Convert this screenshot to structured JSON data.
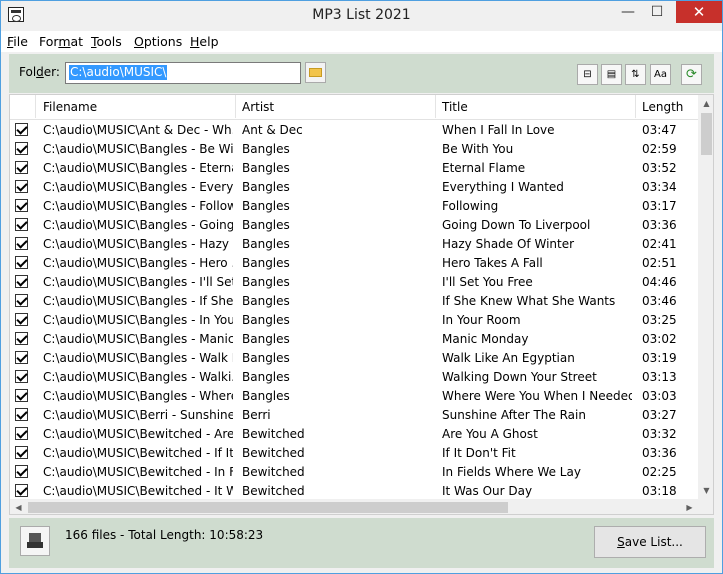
{
  "window": {
    "title": "MP3 List 2021"
  },
  "menu": [
    {
      "pre": "",
      "acc": "F",
      "post": "ile"
    },
    {
      "pre": "For",
      "acc": "m",
      "post": "at"
    },
    {
      "pre": "",
      "acc": "T",
      "post": "ools"
    },
    {
      "pre": "",
      "acc": "O",
      "post": "ptions"
    },
    {
      "pre": "",
      "acc": "H",
      "post": "elp"
    }
  ],
  "toolbar": {
    "folder_label_pre": "Fol",
    "folder_label_acc": "d",
    "folder_label_post": "er:",
    "folder_value": "C:\\audio\\MUSIC\\"
  },
  "columns": {
    "filename": "Filename",
    "artist": "Artist",
    "title": "Title",
    "length": "Length"
  },
  "rows": [
    {
      "file": "C:\\audio\\MUSIC\\Ant & Dec - Wh...",
      "artist": "Ant & Dec",
      "title": "When I Fall In Love",
      "len": "03:47"
    },
    {
      "file": "C:\\audio\\MUSIC\\Bangles - Be Wit...",
      "artist": "Bangles",
      "title": "Be With You",
      "len": "02:59"
    },
    {
      "file": "C:\\audio\\MUSIC\\Bangles - Eterna...",
      "artist": "Bangles",
      "title": "Eternal Flame",
      "len": "03:52"
    },
    {
      "file": "C:\\audio\\MUSIC\\Bangles - Everyt...",
      "artist": "Bangles",
      "title": "Everything I Wanted",
      "len": "03:34"
    },
    {
      "file": "C:\\audio\\MUSIC\\Bangles - Follow...",
      "artist": "Bangles",
      "title": "Following",
      "len": "03:17"
    },
    {
      "file": "C:\\audio\\MUSIC\\Bangles - Going ...",
      "artist": "Bangles",
      "title": "Going Down To Liverpool",
      "len": "03:36"
    },
    {
      "file": "C:\\audio\\MUSIC\\Bangles - Hazy S...",
      "artist": "Bangles",
      "title": "Hazy Shade Of Winter",
      "len": "02:41"
    },
    {
      "file": "C:\\audio\\MUSIC\\Bangles - Hero ...",
      "artist": "Bangles",
      "title": "Hero Takes A Fall",
      "len": "02:51"
    },
    {
      "file": "C:\\audio\\MUSIC\\Bangles - I'll Set ...",
      "artist": "Bangles",
      "title": "I'll Set You Free",
      "len": "04:46"
    },
    {
      "file": "C:\\audio\\MUSIC\\Bangles - If She ...",
      "artist": "Bangles",
      "title": "If She Knew What She Wants",
      "len": "03:46"
    },
    {
      "file": "C:\\audio\\MUSIC\\Bangles - In You...",
      "artist": "Bangles",
      "title": "In Your Room",
      "len": "03:25"
    },
    {
      "file": "C:\\audio\\MUSIC\\Bangles - Manic...",
      "artist": "Bangles",
      "title": "Manic Monday",
      "len": "03:02"
    },
    {
      "file": "C:\\audio\\MUSIC\\Bangles - Walk L...",
      "artist": "Bangles",
      "title": "Walk Like An Egyptian",
      "len": "03:19"
    },
    {
      "file": "C:\\audio\\MUSIC\\Bangles - Walki...",
      "artist": "Bangles",
      "title": "Walking Down Your Street",
      "len": "03:13"
    },
    {
      "file": "C:\\audio\\MUSIC\\Bangles - Where...",
      "artist": "Bangles",
      "title": "Where Were You When I Needed ...",
      "len": "03:03"
    },
    {
      "file": "C:\\audio\\MUSIC\\Berri - Sunshine ...",
      "artist": "Berri",
      "title": "Sunshine After The Rain",
      "len": "03:27"
    },
    {
      "file": "C:\\audio\\MUSIC\\Bewitched - Are ...",
      "artist": "Bewitched",
      "title": "Are You A Ghost",
      "len": "03:32"
    },
    {
      "file": "C:\\audio\\MUSIC\\Bewitched - If It ...",
      "artist": "Bewitched",
      "title": "If It Don't Fit",
      "len": "03:36"
    },
    {
      "file": "C:\\audio\\MUSIC\\Bewitched - In F...",
      "artist": "Bewitched",
      "title": "In Fields Where We Lay",
      "len": "02:25"
    },
    {
      "file": "C:\\audio\\MUSIC\\Bewitched - It W...",
      "artist": "Bewitched",
      "title": "It Was Our Day",
      "len": "03:18"
    }
  ],
  "status": {
    "text": "166 files - Total Length: 10:58:23"
  },
  "save": {
    "acc": "S",
    "post": "ave List..."
  }
}
